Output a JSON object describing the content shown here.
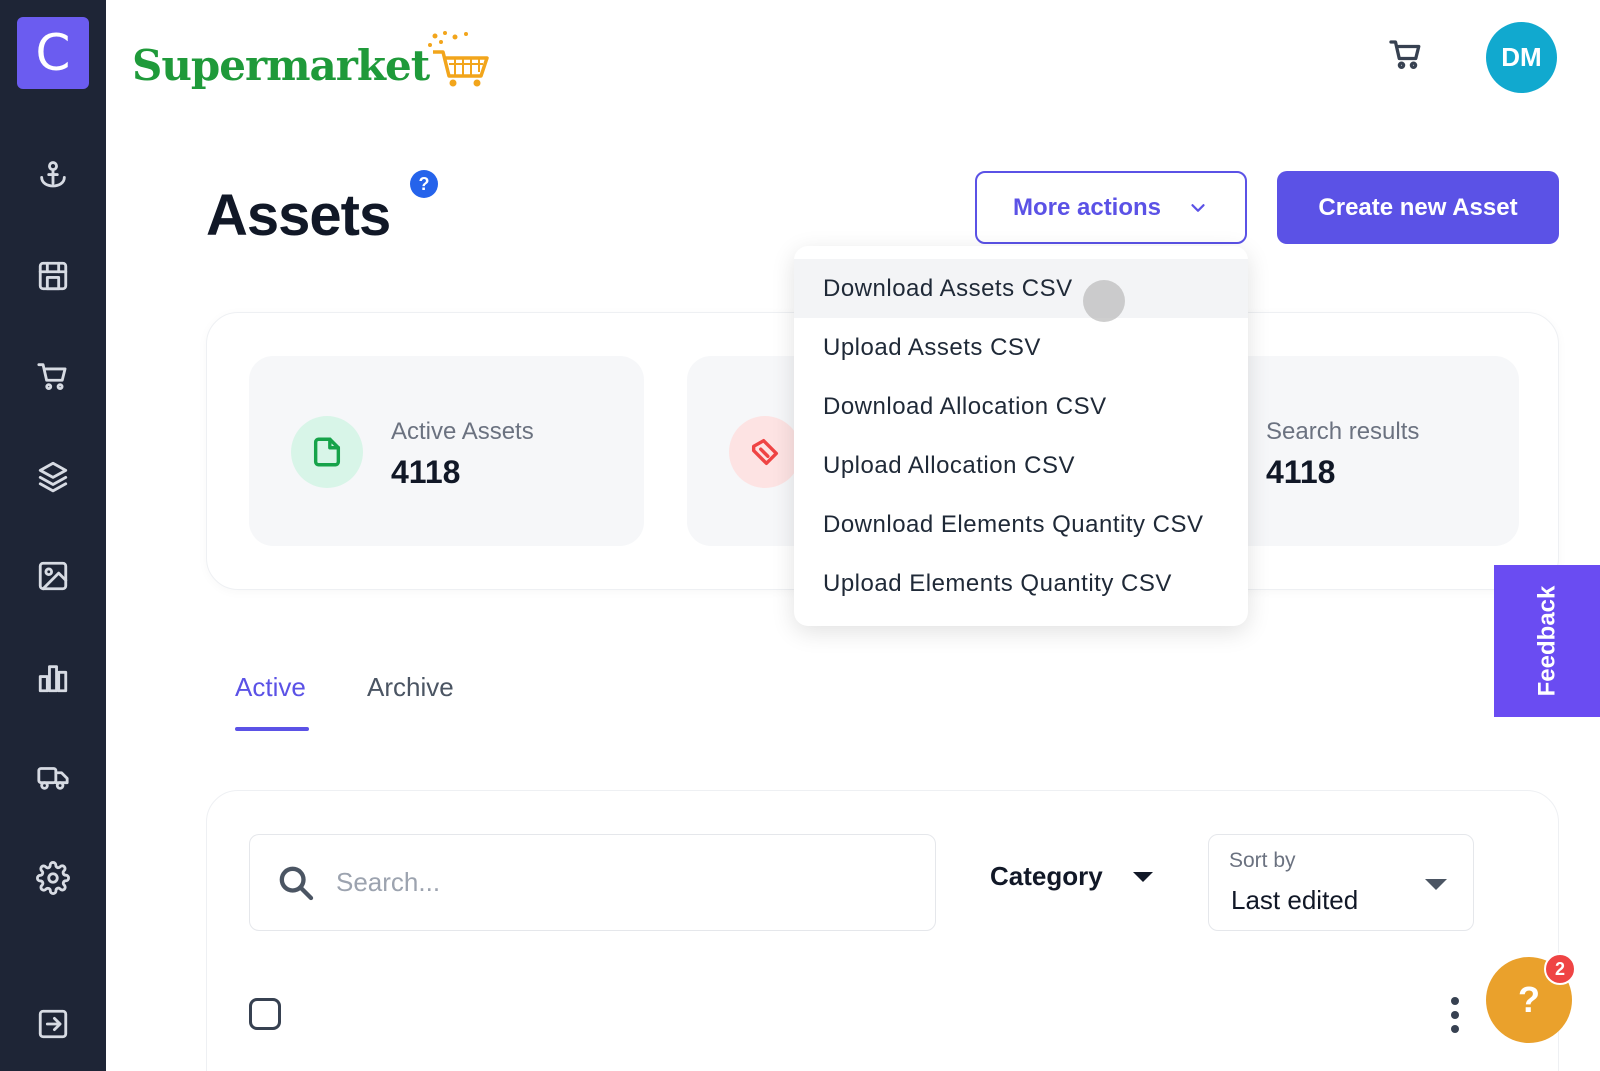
{
  "brand": {
    "letter": "C",
    "logo_text": "Supermarket"
  },
  "sidebar": {
    "items": [
      {
        "icon": "anchor-icon"
      },
      {
        "icon": "store-icon"
      },
      {
        "icon": "cart-icon"
      },
      {
        "icon": "layers-icon"
      },
      {
        "icon": "image-icon"
      },
      {
        "icon": "bar-chart-icon"
      },
      {
        "icon": "truck-icon"
      },
      {
        "icon": "gear-icon"
      },
      {
        "icon": "logout-icon"
      }
    ]
  },
  "header": {
    "avatar_initials": "DM",
    "cart_icon": "cart-icon"
  },
  "page": {
    "title": "Assets",
    "help_label": "?",
    "more_actions_label": "More actions",
    "create_label": "Create new Asset"
  },
  "stats": [
    {
      "label": "Active Assets",
      "value": "4118",
      "icon": "file-icon",
      "color": "#16a34a",
      "bg": "#d8f5e8"
    },
    {
      "label": "",
      "value": "",
      "icon": "tag-icon",
      "color": "#ef4444",
      "bg": "#fde3e3"
    },
    {
      "label": "Search results",
      "value": "4118"
    }
  ],
  "more_actions_menu": {
    "items": [
      "Download Assets CSV",
      "Upload Assets CSV",
      "Download Allocation CSV",
      "Upload Allocation CSV",
      "Download Elements Quantity CSV",
      "Upload Elements Quantity CSV"
    ],
    "highlighted_index": 0
  },
  "feedback": {
    "label": "Feedback"
  },
  "tabs": {
    "active": "Active",
    "archive": "Archive"
  },
  "filters": {
    "search_placeholder": "Search...",
    "category_label": "Category",
    "sort_label": "Sort by",
    "sort_value": "Last edited"
  },
  "help_widget": {
    "label": "?",
    "count": "2"
  },
  "colors": {
    "accent": "#5b52e6",
    "sidebar": "#1e2536",
    "avatar": "#11a9cf",
    "help": "#eaa12c",
    "feedback": "#6a4cf2"
  }
}
